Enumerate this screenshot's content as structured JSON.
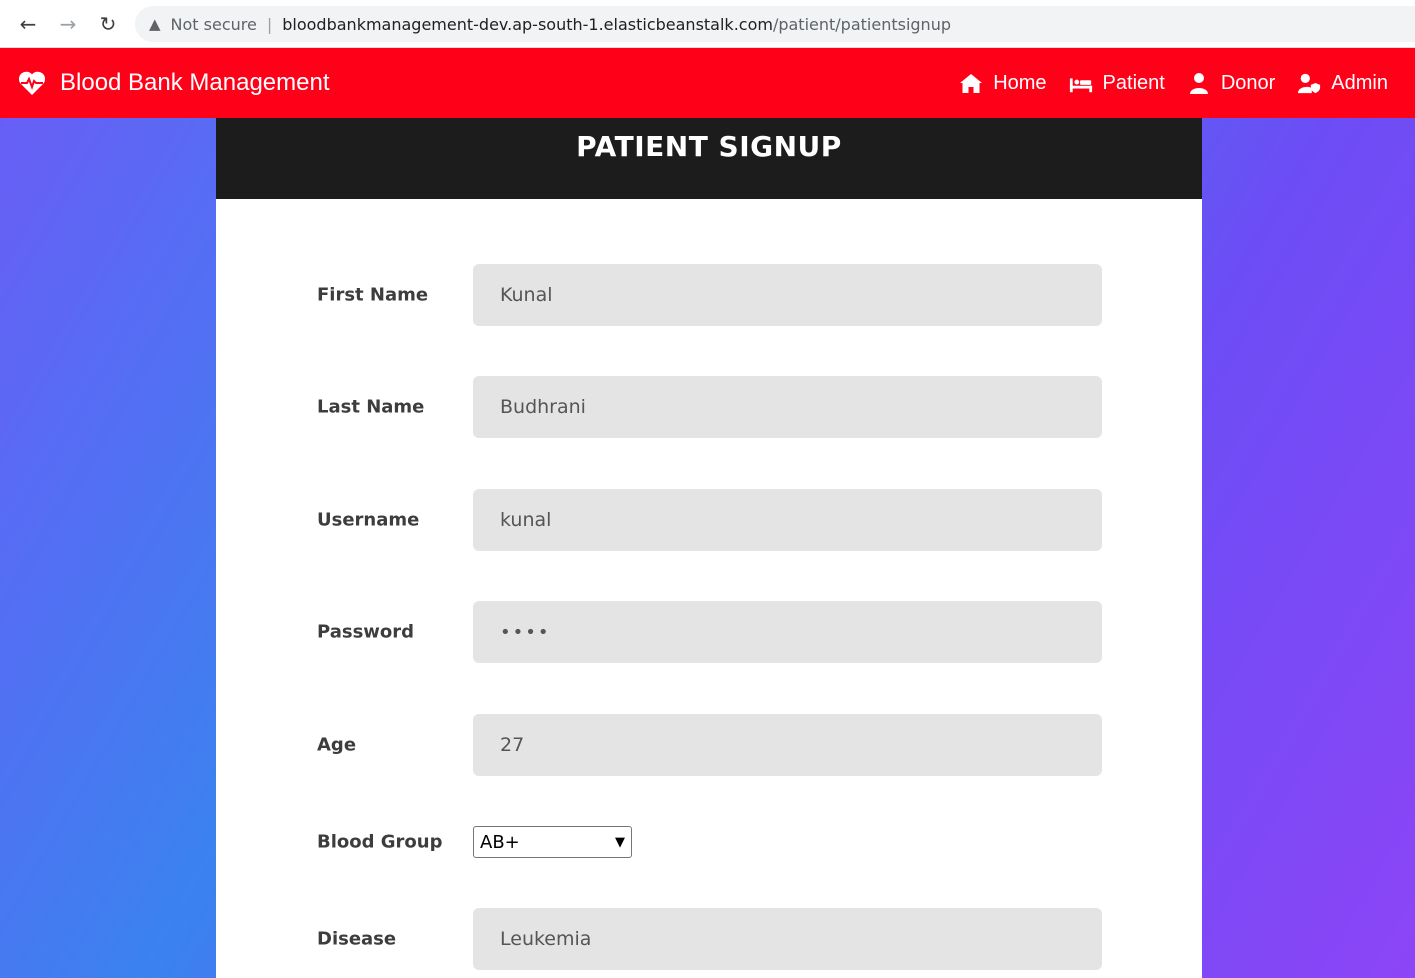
{
  "browser": {
    "security_label": "Not secure",
    "url_host": "bloodbankmanagement-dev.ap-south-1.elasticbeanstalk.com",
    "url_path": "/patient/patientsignup"
  },
  "navbar": {
    "brand": "Blood Bank Management",
    "links": [
      {
        "label": "Home",
        "icon": "home-icon"
      },
      {
        "label": "Patient",
        "icon": "bed-icon"
      },
      {
        "label": "Donor",
        "icon": "user-icon"
      },
      {
        "label": "Admin",
        "icon": "user-shield-icon"
      }
    ],
    "color": "#ff0019"
  },
  "form": {
    "title": "PATIENT SIGNUP",
    "fields": [
      {
        "label": "First Name",
        "value": "Kunal"
      },
      {
        "label": "Last Name",
        "value": "Budhrani"
      },
      {
        "label": "Username",
        "value": "kunal"
      },
      {
        "label": "Password",
        "value": "••••"
      },
      {
        "label": "Age",
        "value": "27"
      },
      {
        "label": "Blood Group",
        "value": "AB+"
      },
      {
        "label": "Disease",
        "value": "Leukemia"
      }
    ]
  }
}
